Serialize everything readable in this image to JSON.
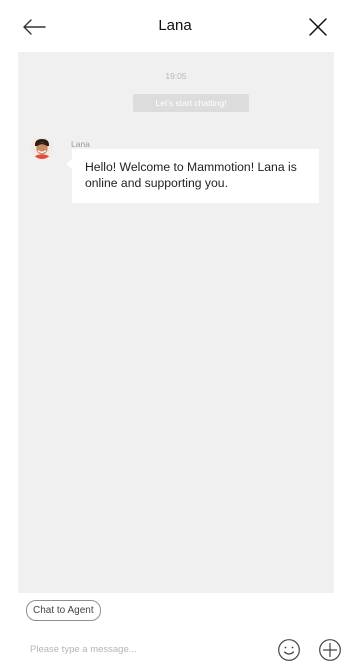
{
  "header": {
    "title": "Lana",
    "back_icon": "arrow-left-icon",
    "close_icon": "close-icon"
  },
  "chat": {
    "timestamp": "19:05",
    "system_message": "Let's start chatting!",
    "messages": [
      {
        "sender": "Lana",
        "avatar_icon": "agent-avatar",
        "text": "Hello! Welcome to Mammotion! Lana is online and supporting you."
      }
    ]
  },
  "footer": {
    "chat_to_agent_label": "Chat to Agent",
    "input_placeholder": "Please type a message...",
    "input_value": "",
    "emoji_icon": "smiley-icon",
    "plus_icon": "plus-circle-icon"
  },
  "colors": {
    "chat_background": "#f0f0f0",
    "bubble_background": "#ffffff",
    "system_pill_background": "#dcdcdc"
  }
}
